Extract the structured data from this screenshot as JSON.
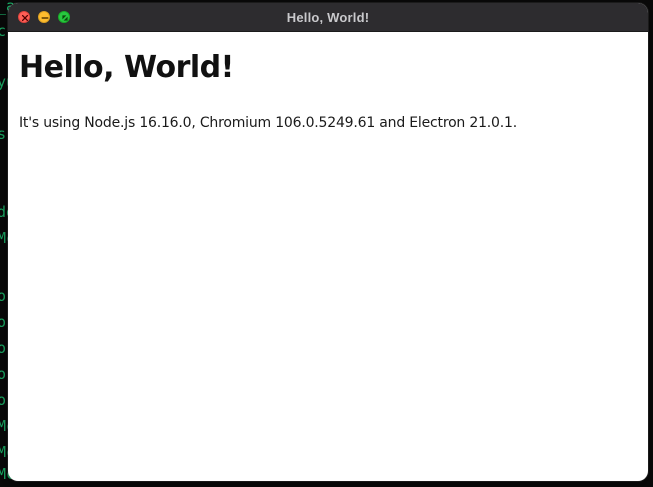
{
  "background_terminal": {
    "lines": [
      "_a",
      "cr",
      "yu",
      "",
      "s",
      "",
      "",
      "",
      "de",
      "Mc",
      "",
      "or",
      "or",
      "or",
      "or",
      "or",
      "Mc",
      "Mc",
      "Mc"
    ]
  },
  "window": {
    "title": "Hello, World!",
    "traffic_lights": {
      "close_icon": "close-icon",
      "minimize_icon": "minimize-icon",
      "maximize_icon": "maximize-icon"
    },
    "heading": "Hello, World!",
    "versions": {
      "prefix": "It's using Node.js ",
      "node": "16.16.0",
      "mid1": ", Chromium ",
      "chromium": "106.0.5249.61",
      "mid2": " and Electron ",
      "electron": "21.0.1",
      "suffix": "."
    }
  },
  "colors": {
    "titlebar": "#2d2c2f",
    "close": "#ff5f57",
    "minimize": "#febc2e",
    "maximize": "#28c840",
    "terminal_text": "#1fd07a"
  }
}
